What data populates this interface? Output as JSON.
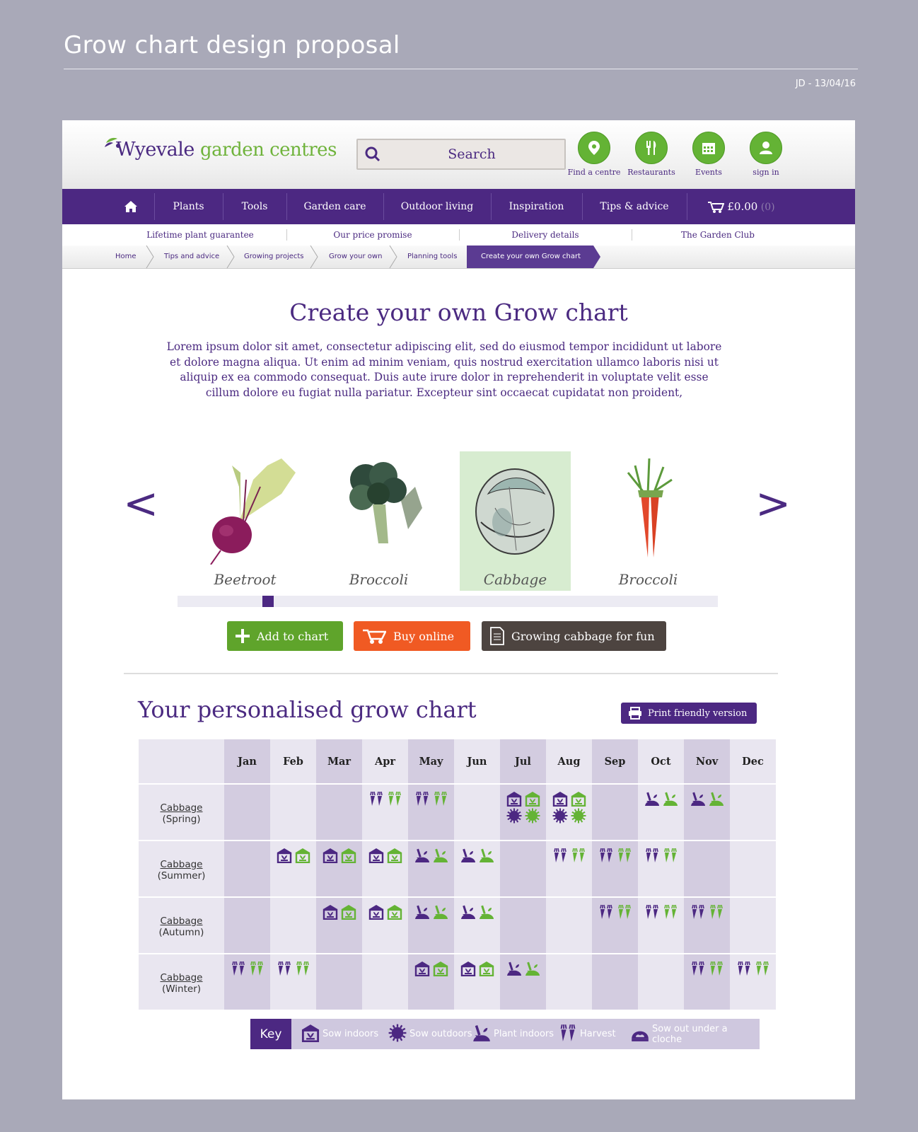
{
  "doc": {
    "title": "Grow chart design proposal",
    "meta": "JD - 13/04/16"
  },
  "header": {
    "logo_brand": "Wyevale",
    "logo_rest": "garden centres",
    "search_placeholder": "Search",
    "icons": [
      {
        "label": "Find a centre",
        "icon": "map-pin-icon"
      },
      {
        "label": "Restaurants",
        "icon": "cutlery-icon"
      },
      {
        "label": "Events",
        "icon": "calendar-icon"
      },
      {
        "label": "sign in",
        "icon": "user-icon"
      }
    ]
  },
  "nav": {
    "items": [
      "Plants",
      "Tools",
      "Garden care",
      "Outdoor living",
      "Inspiration",
      "Tips & advice"
    ],
    "cart_total": "£0.00",
    "cart_count": "(0)"
  },
  "subnav": [
    "Lifetime plant guarantee",
    "Our price promise",
    "Delivery details",
    "The Garden Club"
  ],
  "breadcrumbs": [
    "Home",
    "Tips and advice",
    "Growing projects",
    "Grow your own",
    "Planning tools",
    "Create your own Grow chart"
  ],
  "main": {
    "title": "Create your own Grow chart",
    "intro": "Lorem ipsum dolor sit amet, consectetur adipiscing elit, sed do eiusmod tempor incididunt ut labore et dolore magna aliqua. Ut enim ad minim veniam, quis nostrud exercitation ullamco laboris nisi ut aliquip ex ea commodo consequat. Duis aute irure dolor in reprehenderit in voluptate velit esse cillum dolore eu fugiat nulla pariatur. Excepteur sint occaecat cupidatat non proident,"
  },
  "carousel": {
    "prev": "<",
    "next": ">",
    "plants": [
      {
        "name": "Beetroot",
        "selected": false
      },
      {
        "name": "Broccoli",
        "selected": false
      },
      {
        "name": "Cabbage",
        "selected": true
      },
      {
        "name": "Broccoli",
        "selected": false
      }
    ]
  },
  "actions": {
    "add": "Add to chart",
    "buy": "Buy online",
    "info": "Growing cabbage for fun"
  },
  "colors": {
    "purple": "#4c2882",
    "green": "#64b335",
    "orange": "#f05a23",
    "brown": "#4d4440",
    "lavender": "#d3cce0"
  },
  "chart": {
    "title": "Your personalised grow chart",
    "print": "Print friendly version",
    "months": [
      "Jan",
      "Feb",
      "Mar",
      "Apr",
      "May",
      "Jun",
      "Jul",
      "Aug",
      "Sep",
      "Oct",
      "Nov",
      "Dec"
    ],
    "rows": [
      {
        "name": "Cabbage",
        "variety": "(Spring)",
        "cells": [
          [],
          [],
          [],
          [
            "harvest"
          ],
          [
            "harvest"
          ],
          [],
          [
            "sow-indoors",
            "sow-outdoors"
          ],
          [
            "sow-indoors",
            "sow-outdoors"
          ],
          [],
          [
            "plant-indoors"
          ],
          [
            "plant-indoors"
          ],
          []
        ]
      },
      {
        "name": "Cabbage",
        "variety": "(Summer)",
        "cells": [
          [],
          [
            "sow-indoors"
          ],
          [
            "sow-indoors"
          ],
          [
            "sow-indoors"
          ],
          [
            "plant-indoors"
          ],
          [
            "plant-indoors"
          ],
          [],
          [
            "harvest"
          ],
          [
            "harvest"
          ],
          [
            "harvest"
          ],
          [],
          []
        ]
      },
      {
        "name": "Cabbage",
        "variety": "(Autumn)",
        "cells": [
          [],
          [],
          [
            "sow-indoors"
          ],
          [
            "sow-indoors"
          ],
          [
            "plant-indoors"
          ],
          [
            "plant-indoors"
          ],
          [],
          [],
          [
            "harvest"
          ],
          [
            "harvest"
          ],
          [
            "harvest"
          ],
          []
        ]
      },
      {
        "name": "Cabbage",
        "variety": "(Winter)",
        "cells": [
          [
            "harvest"
          ],
          [
            "harvest"
          ],
          [],
          [],
          [
            "sow-indoors"
          ],
          [
            "sow-indoors"
          ],
          [
            "plant-indoors"
          ],
          [],
          [],
          [],
          [
            "harvest"
          ],
          [
            "harvest"
          ]
        ]
      }
    ]
  },
  "key": {
    "title": "Key",
    "items": [
      {
        "icon": "sow-indoors",
        "label": "Sow indoors"
      },
      {
        "icon": "sow-outdoors",
        "label": "Sow outdoors"
      },
      {
        "icon": "plant-indoors",
        "label": "Plant indoors"
      },
      {
        "icon": "harvest",
        "label": "Harvest"
      },
      {
        "icon": "cloche",
        "label": "Sow out under a cloche"
      }
    ]
  }
}
